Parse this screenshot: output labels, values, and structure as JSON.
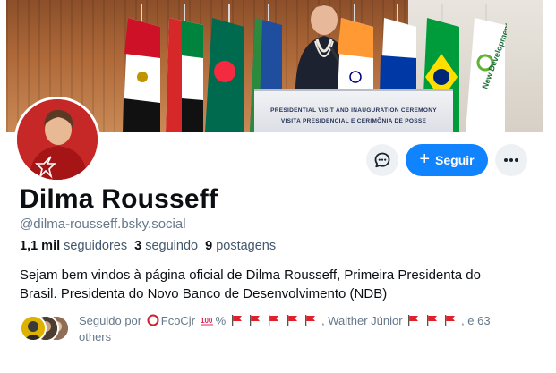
{
  "banner": {
    "podium_line_1": "PRESIDENTIAL VISIT AND INAUGURATION CEREMONY",
    "podium_line_2": "VISITA PRESIDENCIAL E CERIMÔNIA DE POSSE",
    "ndb_text": "New Development Bank"
  },
  "profile": {
    "display_name": "Dilma Rousseff",
    "handle": "@dilma-rousseff.bsky.social",
    "followers_count": "1,1 mil",
    "followers_label": "seguidores",
    "following_count": "3",
    "following_label": "seguindo",
    "posts_count": "9",
    "posts_label": "postagens",
    "bio_line_1": "Sejam bem vindos à página oficial de Dilma Rousseff, Primeira Presidenta do",
    "bio_line_2": "Brasil. Presidenta do Novo Banco de Desenvolvimento (NDB)"
  },
  "actions": {
    "follow_label": "Seguir",
    "message_icon": "message-bubble-icon",
    "more_icon": "ellipsis-icon",
    "follow_color": "#1083fe"
  },
  "followed_by": {
    "prefix": "Seguido por",
    "user_1": "FcoCjr",
    "user_1_suffix": "%",
    "separator": ",",
    "user_2": "Walther Júnior",
    "suffix": ", e 63",
    "suffix_2": "others"
  }
}
